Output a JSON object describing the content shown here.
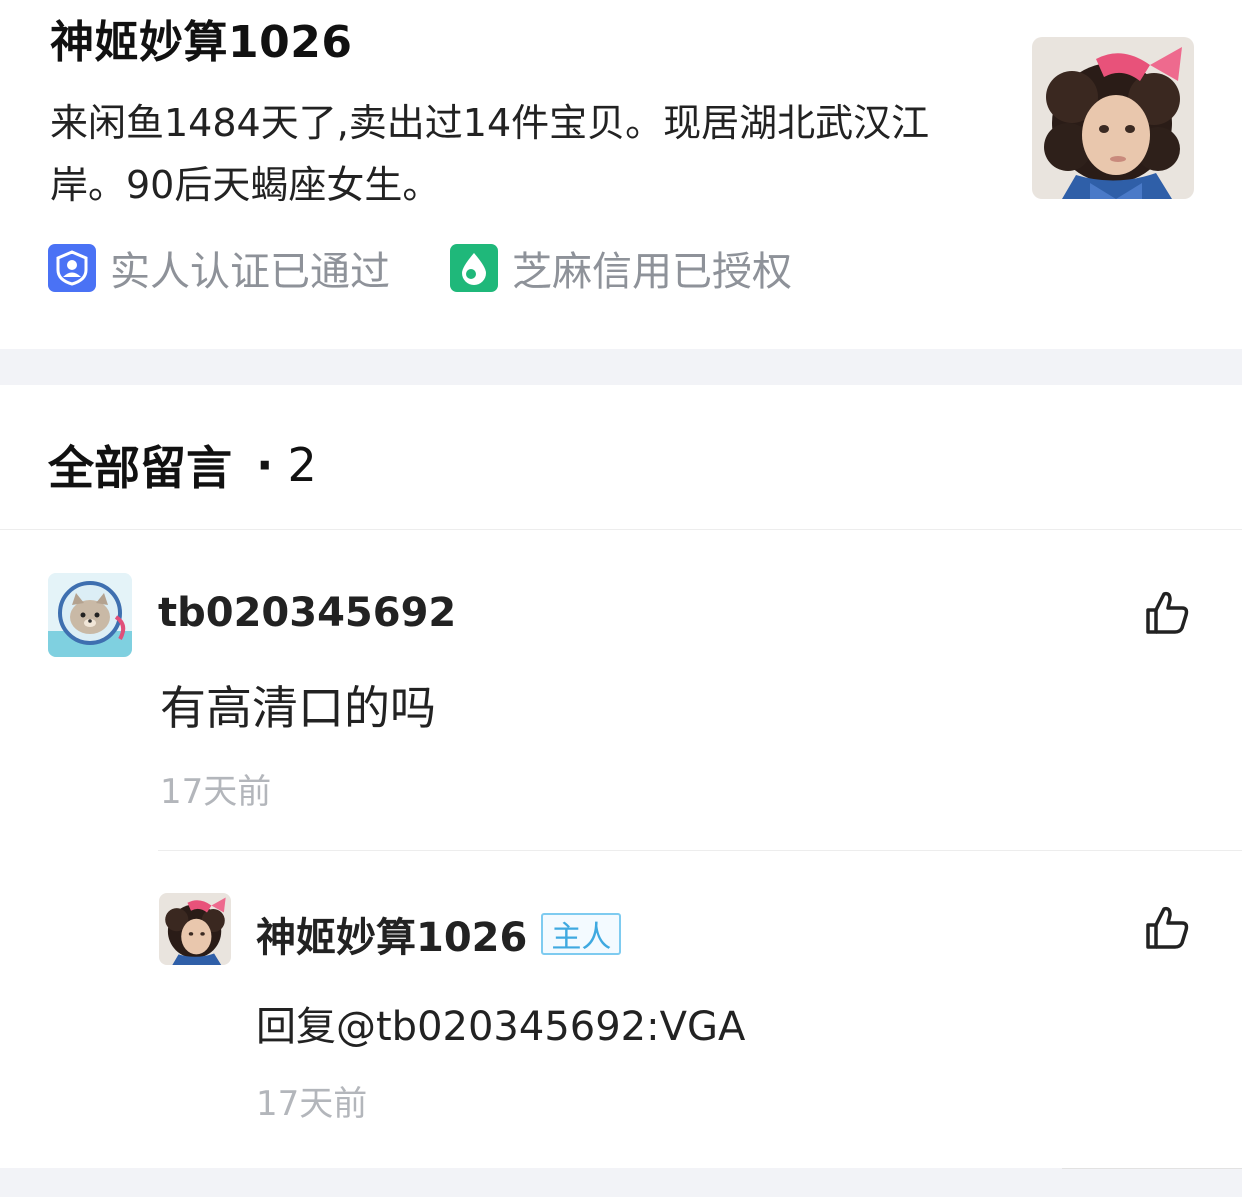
{
  "seller": {
    "name": "神姬妙算1026",
    "description": "来闲鱼1484天了,卖出过14件宝贝。现居湖北武汉江岸。90后天蝎座女生。",
    "avatar_icon": "girl-portrait-avatar",
    "badges": {
      "verify": {
        "label": "实人认证已通过",
        "icon": "person-shield-icon",
        "color": "#4a72f5"
      },
      "credit": {
        "label": "芝麻信用已授权",
        "icon": "sesame-drop-icon",
        "color": "#1fb87a"
      }
    }
  },
  "comments": {
    "title": "全部留言",
    "separator": "·",
    "count": "2",
    "items": [
      {
        "user": "tb020345692",
        "avatar_icon": "cat-astronaut-avatar",
        "text": "有高清口的吗",
        "time": "17天前",
        "like_icon": "thumbs-up-icon",
        "reply": {
          "user": "神姬妙算1026",
          "tag": "主人",
          "avatar_icon": "girl-portrait-avatar",
          "text": "回复@tb020345692:VGA",
          "time": "17天前",
          "like_icon": "thumbs-up-icon"
        }
      }
    ]
  }
}
